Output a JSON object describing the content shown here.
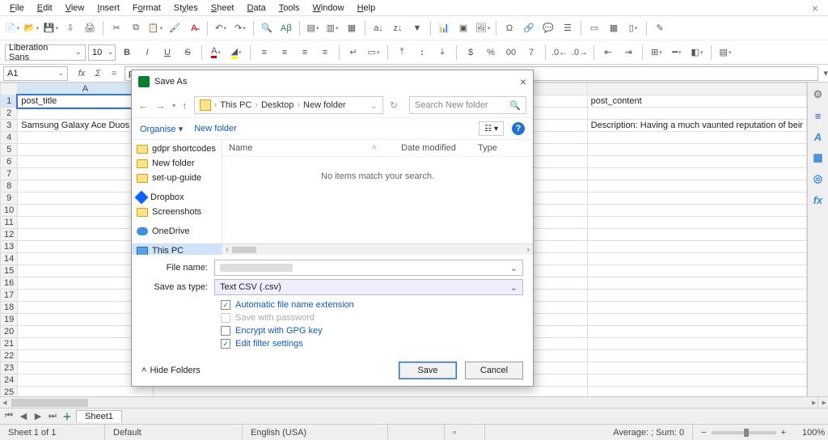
{
  "menu": {
    "items": [
      "File",
      "Edit",
      "View",
      "Insert",
      "Format",
      "Styles",
      "Sheet",
      "Data",
      "Tools",
      "Window",
      "Help"
    ]
  },
  "format": {
    "font_name": "Liberation Sans",
    "font_size": "10"
  },
  "name_box": "A1",
  "formula_value": "post_title",
  "columns": [
    "A"
  ],
  "cells": {
    "A1": "post_title",
    "rightcell_row1": "post_content",
    "row3_left": "Samsung Galaxy Ace Duos B",
    "row3_right": "Description: Having a much vaunted reputation of beir"
  },
  "dialog": {
    "title": "Save As",
    "breadcrumbs": [
      "This PC",
      "Desktop",
      "New folder"
    ],
    "search_placeholder": "Search New folder",
    "organise": "Organise",
    "new_folder": "New folder",
    "columns": {
      "name": "Name",
      "date": "Date modified",
      "type": "Type"
    },
    "empty_msg": "No items match your search.",
    "tree": [
      {
        "label": "gdpr shortcodes",
        "ico": "folder"
      },
      {
        "label": "New folder",
        "ico": "folder"
      },
      {
        "label": "set-up-guide",
        "ico": "folder"
      },
      {
        "label": "Dropbox",
        "ico": "dbox"
      },
      {
        "label": "Screenshots",
        "ico": "folder"
      },
      {
        "label": "OneDrive",
        "ico": "cloud"
      },
      {
        "label": "This PC",
        "ico": "pc",
        "sel": true
      }
    ],
    "file_name_label": "File name:",
    "save_type_label": "Save as type:",
    "save_type_value": "Text CSV (.csv)",
    "check_auto_ext": "Automatic file name extension",
    "check_save_pw": "Save with password",
    "check_gpg": "Encrypt with GPG key",
    "check_filter": "Edit filter settings",
    "hide_folders": "Hide Folders",
    "save_btn": "Save",
    "cancel_btn": "Cancel"
  },
  "sheet_tab": "Sheet1",
  "status": {
    "sheet_of": "Sheet 1 of 1",
    "style": "Default",
    "lang": "English (USA)",
    "summary": "Average: ; Sum: 0",
    "zoom": "100%"
  }
}
